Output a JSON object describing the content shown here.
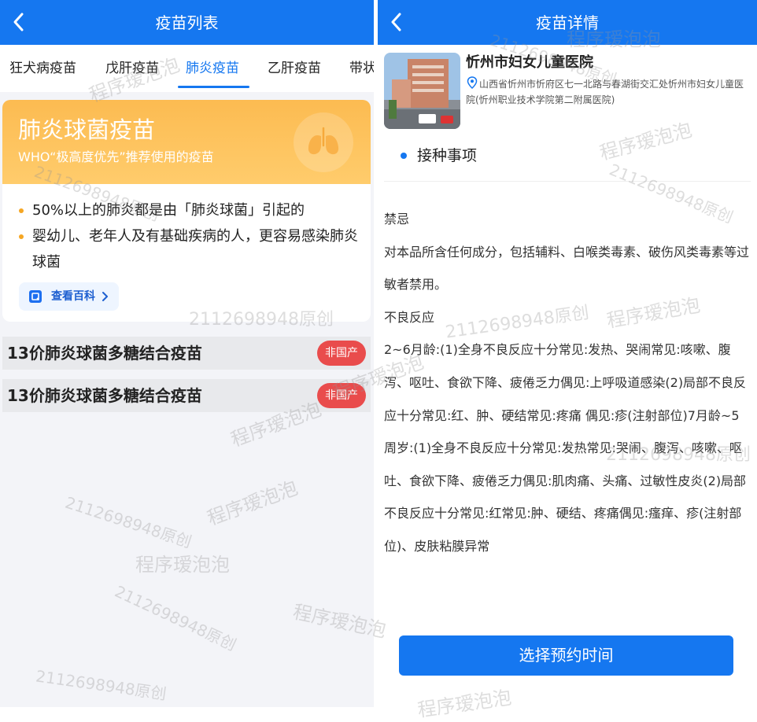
{
  "left": {
    "title": "疫苗列表",
    "tabs": [
      "狂犬病疫苗",
      "戊肝疫苗",
      "肺炎疫苗",
      "乙肝疫苗",
      "带状"
    ],
    "active_tab_index": 2,
    "card": {
      "title": "肺炎球菌疫苗",
      "subtitle": "WHO“极高度优先”推荐使用的疫苗",
      "bullets": [
        "50%以上的肺炎都是由「肺炎球菌」引起的",
        "婴幼儿、老年人及有基础疾病的人，更容易感染肺炎球菌"
      ],
      "wiki_label": "查看百科"
    },
    "vaccines": [
      {
        "name": "13价肺炎球菌多糖结合疫苗",
        "badge": "非国产"
      },
      {
        "name": "13价肺炎球菌多糖结合疫苗",
        "badge": "非国产"
      }
    ]
  },
  "right": {
    "title": "疫苗详情",
    "hospital": {
      "name": "忻州市妇女儿童医院",
      "address": "山西省忻州市忻府区七一北路与春湖街交汇处忻州市妇女儿童医院(忻州职业技术学院第二附属医院)"
    },
    "section_title": "接种事项",
    "details": [
      "禁忌",
      "对本品所含任何成分，包括辅料、白喉类毒素、破伤风类毒素等过敏者禁用。",
      "不良反应",
      "2~6月龄:(1)全身不良反应十分常见:发热、哭闹常见:咳嗽、腹泻、呕吐、食欲下降、疲倦乏力偶见:上呼吸道感染(2)局部不良反应十分常见:红、肿、硬结常见:疼痛 偶见:疹(注射部位)7月龄~5周岁:(1)全身不良反应十分常见:发热常见:哭闹、腹泻、咳嗽、呕吐、食欲下降、疲倦乏力偶见:肌肉痛、头痛、过敏性皮炎(2)局部不良反应十分常见:红常见:肿、硬结、疼痛偶见:瘙痒、疹(注射部位)、皮肤粘膜异常"
    ],
    "cta_label": "选择预约时间"
  },
  "watermarks": [
    "程序瑷泡泡",
    "2112698948原创"
  ],
  "colors": {
    "primary": "#1577f0",
    "card_orange": "#fcbb51",
    "badge_red": "#e94c4c",
    "bullet_dot": "#f5a623"
  },
  "icons": [
    "back-arrow-icon",
    "lung-icon",
    "book-icon",
    "chevron-right-icon",
    "location-pin-icon"
  ]
}
